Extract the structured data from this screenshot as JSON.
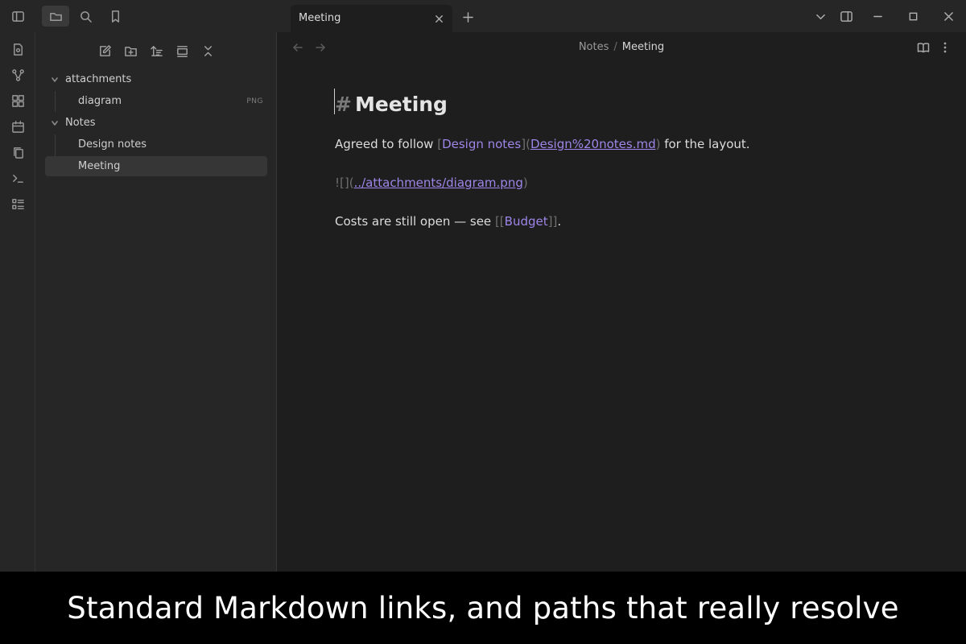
{
  "tab": {
    "title": "Meeting"
  },
  "explorer": {
    "tree": [
      {
        "label": "attachments",
        "type": "folder"
      },
      {
        "label": "diagram",
        "type": "file",
        "badge": "PNG"
      },
      {
        "label": "Notes",
        "type": "folder"
      },
      {
        "label": "Design notes",
        "type": "file"
      },
      {
        "label": "Meeting",
        "type": "file",
        "selected": true
      }
    ]
  },
  "breadcrumb": {
    "parent": "Notes",
    "separator": "/",
    "current": "Meeting"
  },
  "document": {
    "heading_mark": "#",
    "heading": "Meeting",
    "line1": {
      "before": "Agreed to follow ",
      "open_bracket": "[",
      "link_text": "Design notes",
      "mid": "](",
      "url": "Design%20notes.md",
      "close_paren": ")",
      "after": " for the layout."
    },
    "line2": {
      "prefix": "![](",
      "url": "../attachments/diagram.png",
      "close_paren": ")"
    },
    "line3": {
      "before": "Costs are still open — see ",
      "open": "[[",
      "link_text": "Budget",
      "close": "]]",
      "after": "."
    }
  },
  "caption": "Standard Markdown links, and paths that really resolve",
  "colors": {
    "accent": "#9d86e8",
    "editor_bg": "#1e1e1e",
    "panel_bg": "#262626"
  }
}
